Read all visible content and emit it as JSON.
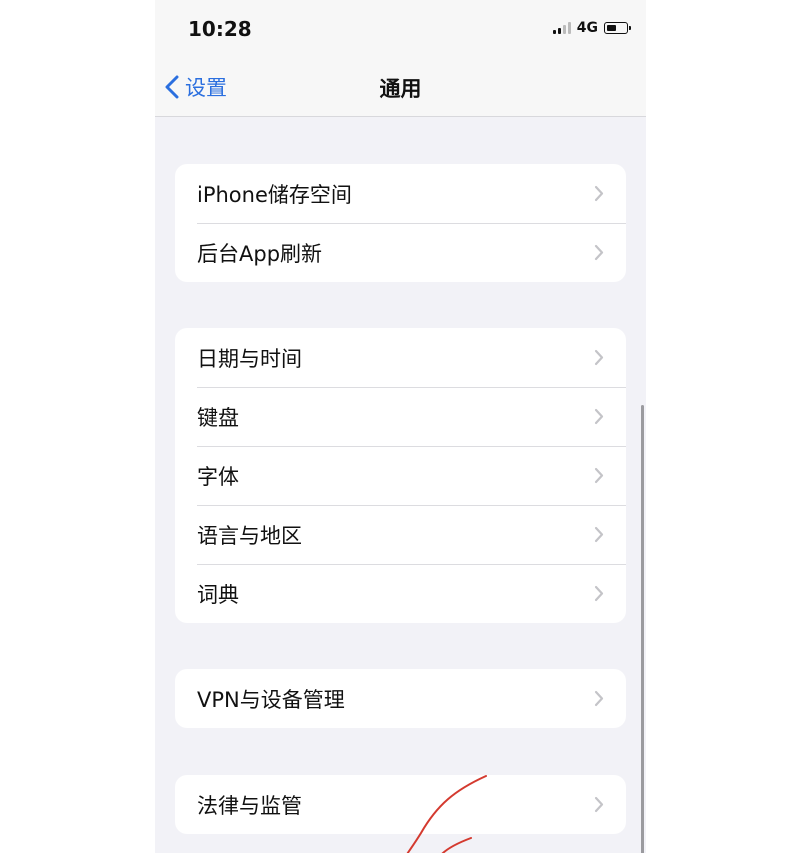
{
  "status": {
    "time": "10:28",
    "network": "4G",
    "battery_level": 0.55,
    "signal_bars": 4,
    "signal_active": 2
  },
  "nav": {
    "back_label": "设置",
    "title": "通用"
  },
  "groups": [
    {
      "items": [
        {
          "label": "iPhone储存空间"
        },
        {
          "label": "后台App刷新"
        }
      ]
    },
    {
      "items": [
        {
          "label": "日期与时间"
        },
        {
          "label": "键盘"
        },
        {
          "label": "字体"
        },
        {
          "label": "语言与地区"
        },
        {
          "label": "词典"
        }
      ]
    },
    {
      "items": [
        {
          "label": "VPN与设备管理"
        }
      ]
    },
    {
      "items": [
        {
          "label": "法律与监管"
        }
      ]
    }
  ],
  "icons": {
    "back": "chevron-left-icon",
    "disclosure": "chevron-right-icon"
  },
  "colors": {
    "accent": "#2b6fdf",
    "annotation": "#d43a2f",
    "background": "#f2f2f7"
  }
}
